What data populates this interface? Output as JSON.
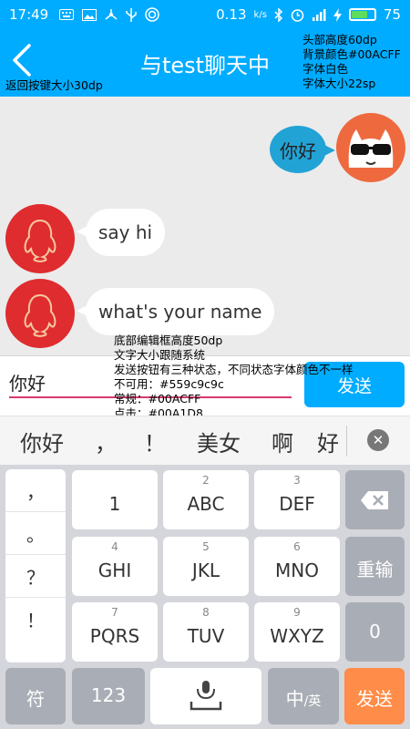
{
  "status_bar": {
    "time": "17:49",
    "network_speed": "0.13",
    "network_unit": "k/s",
    "battery_percent": "75",
    "battery_level": 0.75,
    "left_icons": [
      "keyboard-icon",
      "image-icon",
      "share-icon",
      "usb-icon",
      "signal-icon"
    ],
    "right_icons": [
      "bluetooth-icon",
      "alarm-icon",
      "wifi-icon",
      "charging-icon"
    ]
  },
  "header": {
    "title": "与test聊天中",
    "background_color": "#00ACFF",
    "annotation_lines": [
      "头部高度60dp",
      "背景颜色#00ACFF",
      "字体白色",
      "字体大小22sp"
    ],
    "back_annotation": "返回按键大小30dp"
  },
  "messages": [
    {
      "sender": "self",
      "text": "你好"
    },
    {
      "sender": "other",
      "text": "say hi"
    },
    {
      "sender": "other",
      "text": "what's your name"
    }
  ],
  "compose": {
    "input_value": "你好",
    "send_label": "发送",
    "annotation_lines": [
      "底部编辑框高度50dp",
      "文字大小跟随系统",
      "发送按钮有三种状态，不同状态字体颜色不一样",
      "不可用：#559c9c9c",
      "常规：#00ACFF",
      "点击：#00A1D8"
    ]
  },
  "candidates": [
    "你好",
    "，",
    "！",
    "美女",
    "啊",
    "好"
  ],
  "keyboard": {
    "punctuation": [
      "，",
      "。",
      "？",
      "！"
    ],
    "keys": [
      {
        "num": "",
        "label": "1"
      },
      {
        "num": "2",
        "label": "ABC"
      },
      {
        "num": "3",
        "label": "DEF"
      },
      {
        "num": "4",
        "label": "GHI"
      },
      {
        "num": "5",
        "label": "JKL"
      },
      {
        "num": "6",
        "label": "MNO"
      },
      {
        "num": "7",
        "label": "PQRS"
      },
      {
        "num": "8",
        "label": "TUV"
      },
      {
        "num": "9",
        "label": "WXYZ"
      }
    ],
    "reenter_label": "重输",
    "zero_label": "0",
    "symbol_label": "符",
    "numeric_label": "123",
    "lang_label_main": "中",
    "lang_label_sub": "/英",
    "send_label": "发送"
  }
}
